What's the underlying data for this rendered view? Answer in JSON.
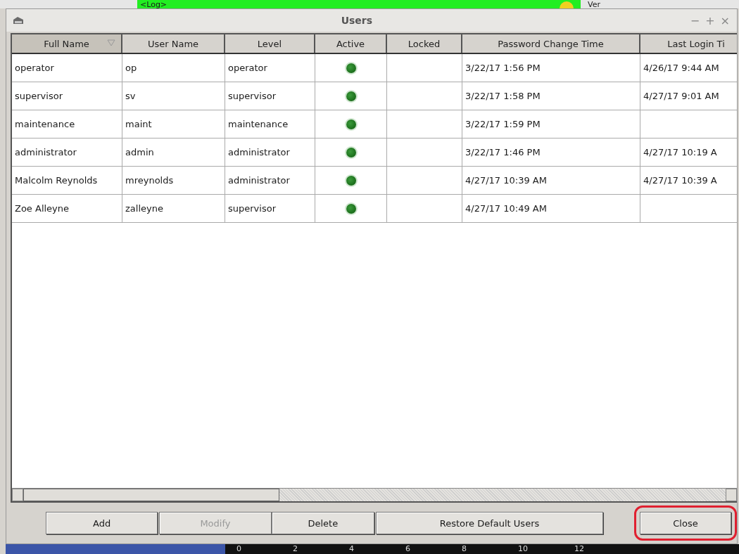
{
  "background": {
    "log_label": "<Log>",
    "ver_label": "Ver",
    "axis_ticks": [
      "0",
      "2",
      "4",
      "6",
      "8",
      "10",
      "12"
    ]
  },
  "window": {
    "title": "Users",
    "controls": [
      "−",
      "+",
      "×"
    ]
  },
  "table": {
    "columns": [
      {
        "label": "Full Name",
        "sorted": true
      },
      {
        "label": "User Name",
        "sorted": false
      },
      {
        "label": "Level",
        "sorted": false
      },
      {
        "label": "Active",
        "sorted": false
      },
      {
        "label": "Locked",
        "sorted": false
      },
      {
        "label": "Password Change Time",
        "sorted": false
      },
      {
        "label": "Last Login Ti",
        "sorted": false
      }
    ],
    "rows": [
      {
        "full_name": "operator",
        "user_name": "op",
        "level": "operator",
        "active": true,
        "password_change_time": "3/22/17 1:56 PM",
        "last_login_time": "4/26/17 9:44 AM"
      },
      {
        "full_name": "supervisor",
        "user_name": "sv",
        "level": "supervisor",
        "active": true,
        "password_change_time": "3/22/17 1:58 PM",
        "last_login_time": "4/27/17 9:01 AM"
      },
      {
        "full_name": "maintenance",
        "user_name": "maint",
        "level": "maintenance",
        "active": true,
        "password_change_time": "3/22/17 1:59 PM"
      },
      {
        "full_name": "administrator",
        "user_name": "admin",
        "level": "administrator",
        "active": true,
        "password_change_time": "3/22/17 1:46 PM",
        "last_login_time": "4/27/17 10:19 A"
      },
      {
        "full_name": "Malcolm Reynolds",
        "user_name": "mreynolds",
        "level": "administrator",
        "active": true,
        "password_change_time": "4/27/17 10:39 AM",
        "last_login_time": "4/27/17 10:39 A"
      },
      {
        "full_name": "Zoe Alleyne",
        "user_name": "zalleyne",
        "level": "supervisor",
        "active": true,
        "password_change_time": "4/27/17 10:49 AM"
      }
    ]
  },
  "buttons": [
    {
      "label": "Add",
      "disabled": false,
      "highlighted": false
    },
    {
      "label": "Modify",
      "disabled": true,
      "highlighted": false
    },
    {
      "label": "Delete",
      "disabled": false,
      "highlighted": false
    },
    {
      "label": "Restore Default Users",
      "disabled": false,
      "highlighted": false
    },
    {
      "label": "Close",
      "disabled": false,
      "highlighted": true
    }
  ]
}
